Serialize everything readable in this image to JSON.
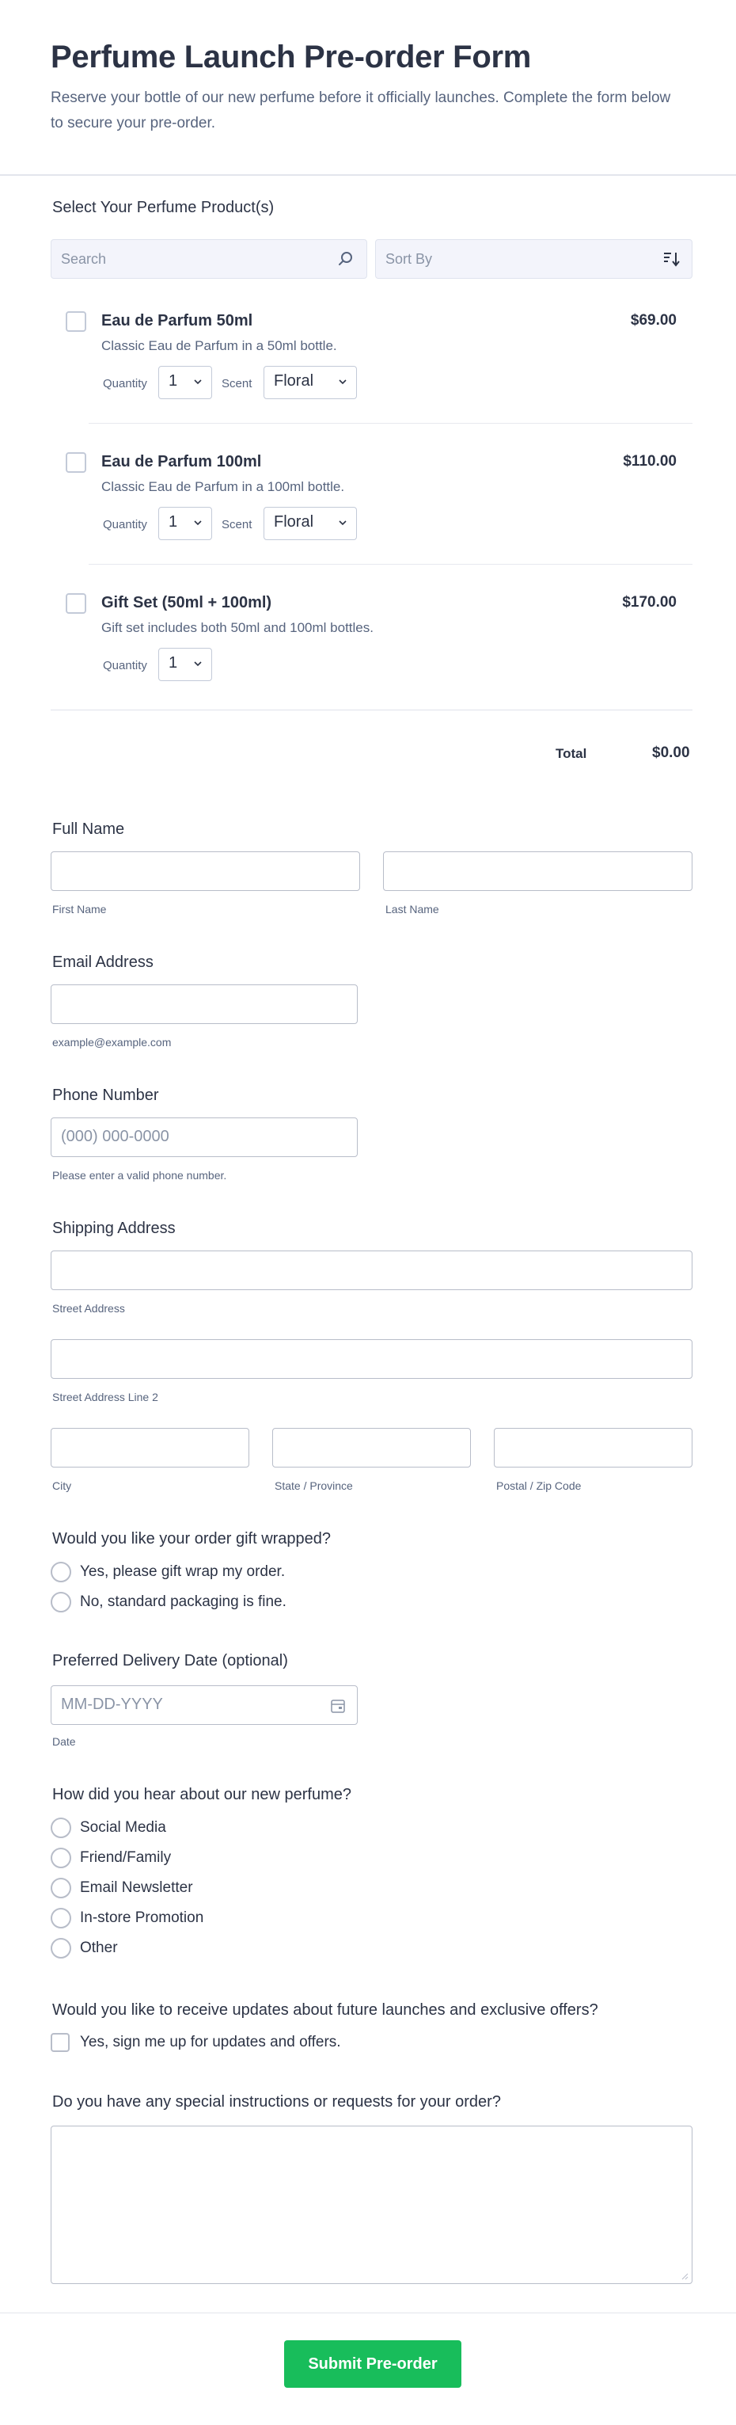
{
  "header": {
    "title": "Perfume Launch Pre-order Form",
    "subtitle": "Reserve your bottle of our new perfume before it officially launches. Complete the form below to secure your pre-order."
  },
  "products": {
    "label": "Select Your Perfume Product(s)",
    "search_placeholder": "Search",
    "sort_placeholder": "Sort By",
    "quantity_label": "Quantity",
    "scent_label": "Scent",
    "items": [
      {
        "name": "Eau de Parfum 50ml",
        "description": "Classic Eau de Parfum in a 50ml bottle.",
        "price": "$69.00",
        "quantity": "1",
        "scent": "Floral"
      },
      {
        "name": "Eau de Parfum 100ml",
        "description": "Classic Eau de Parfum in a 100ml bottle.",
        "price": "$110.00",
        "quantity": "1",
        "scent": "Floral"
      },
      {
        "name": "Gift Set (50ml + 100ml)",
        "description": "Gift set includes both 50ml and 100ml bottles.",
        "price": "$170.00",
        "quantity": "1"
      }
    ],
    "total_label": "Total",
    "total_value": "$0.00"
  },
  "full_name": {
    "label": "Full Name",
    "first_sublabel": "First Name",
    "last_sublabel": "Last Name"
  },
  "email": {
    "label": "Email Address",
    "sublabel": "example@example.com"
  },
  "phone": {
    "label": "Phone Number",
    "placeholder": "(000) 000-0000",
    "sublabel": "Please enter a valid phone number."
  },
  "address": {
    "label": "Shipping Address",
    "street_sublabel": "Street Address",
    "street2_sublabel": "Street Address Line 2",
    "city_sublabel": "City",
    "state_sublabel": "State / Province",
    "zip_sublabel": "Postal / Zip Code"
  },
  "gift_wrap": {
    "label": "Would you like your order gift wrapped?",
    "options": [
      "Yes, please gift wrap my order.",
      "No, standard packaging is fine."
    ]
  },
  "delivery_date": {
    "label": "Preferred Delivery Date (optional)",
    "placeholder": "MM-DD-YYYY",
    "sublabel": "Date"
  },
  "hear_about": {
    "label": "How did you hear about our new perfume?",
    "options": [
      "Social Media",
      "Friend/Family",
      "Email Newsletter",
      "In-store Promotion",
      "Other"
    ]
  },
  "updates": {
    "label": "Would you like to receive updates about future launches and exclusive offers?",
    "option": "Yes, sign me up for updates and offers."
  },
  "instructions": {
    "label": "Do you have any special instructions or requests for your order?"
  },
  "submit": {
    "label": "Submit Pre-order",
    "color": "#18bd5b"
  }
}
